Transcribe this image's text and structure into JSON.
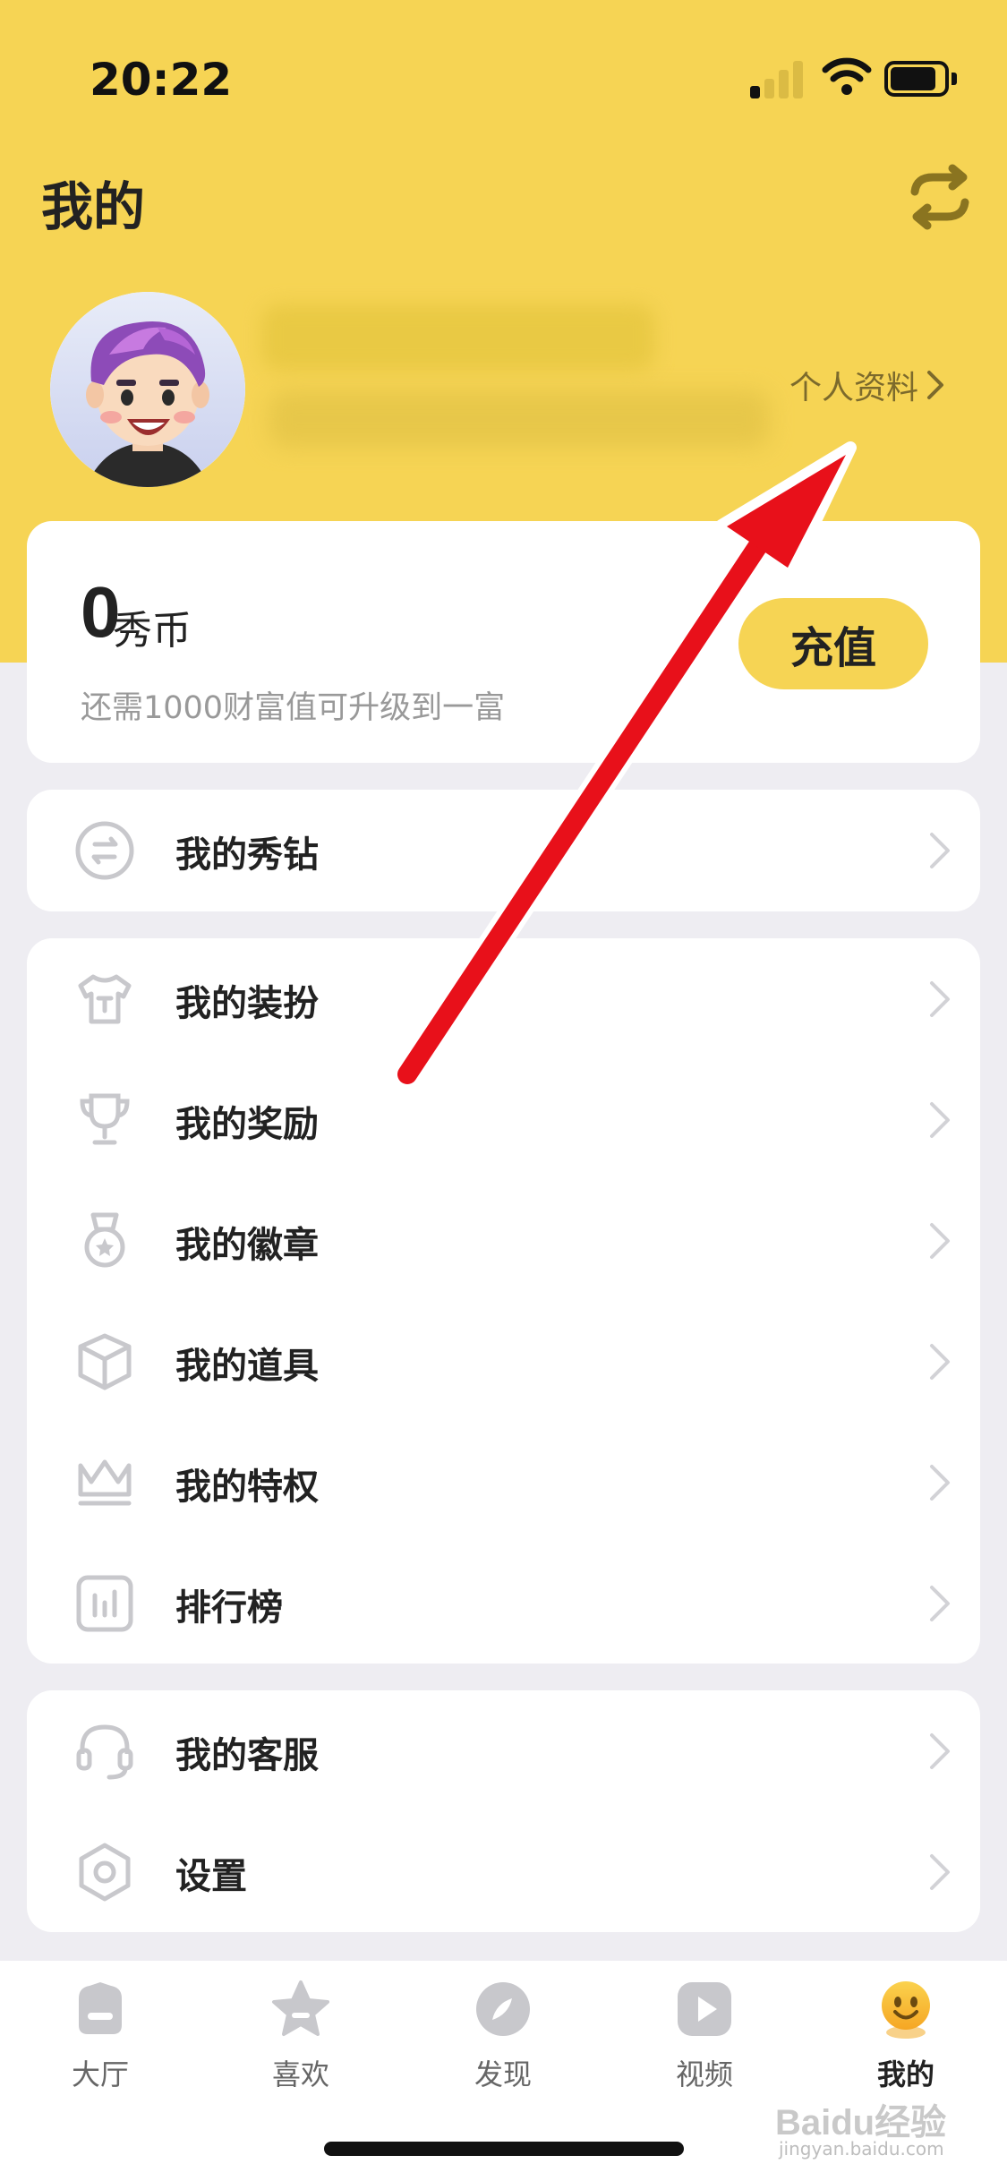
{
  "status_bar": {
    "time": "20:22"
  },
  "header": {
    "title": "我的",
    "switch_icon": "switch-arrows-icon"
  },
  "profile": {
    "avatar": "cartoon-boy-avatar",
    "link_label": "个人资料"
  },
  "wallet": {
    "coins": "0",
    "unit": "秀币",
    "tip": "还需1000财富值可升级到一富",
    "recharge_label": "充值"
  },
  "menu_groups": [
    {
      "items": [
        {
          "label": "我的秀钻",
          "icon": "diamond-coin-icon"
        }
      ]
    },
    {
      "items": [
        {
          "label": "我的装扮",
          "icon": "tshirt-icon"
        },
        {
          "label": "我的奖励",
          "icon": "trophy-icon"
        },
        {
          "label": "我的徽章",
          "icon": "medal-icon"
        },
        {
          "label": "我的道具",
          "icon": "box-icon"
        },
        {
          "label": "我的特权",
          "icon": "crown-icon"
        },
        {
          "label": "排行榜",
          "icon": "ranking-chart-icon"
        }
      ]
    },
    {
      "items": [
        {
          "label": "我的客服",
          "icon": "headset-icon"
        },
        {
          "label": "设置",
          "icon": "settings-hexagon-icon"
        }
      ]
    }
  ],
  "tabbar": [
    {
      "label": "大厅",
      "icon": "home-icon"
    },
    {
      "label": "喜欢",
      "icon": "star-icon"
    },
    {
      "label": "发现",
      "icon": "compass-icon"
    },
    {
      "label": "视频",
      "icon": "play-icon"
    },
    {
      "label": "我的",
      "icon": "profile-face-icon",
      "active": true
    }
  ],
  "watermark": {
    "brand": "Baidu经验",
    "url": "jingyan.baidu.com"
  },
  "colors": {
    "accent_yellow": "#F6D454",
    "arrow_red": "#E8101A",
    "background": "#EEEDF2"
  }
}
